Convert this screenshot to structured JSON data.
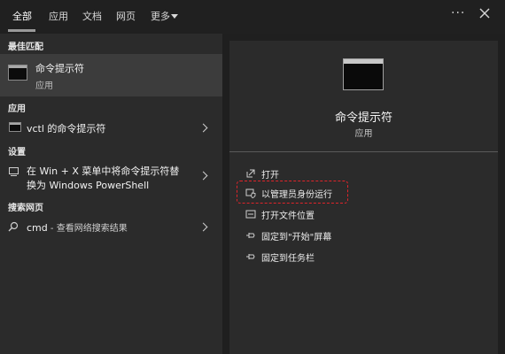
{
  "tabs": [
    {
      "label": "全部"
    },
    {
      "label": "应用"
    },
    {
      "label": "文档"
    },
    {
      "label": "网页"
    },
    {
      "label": "更多"
    }
  ],
  "toolbar": {
    "more_options": "···"
  },
  "left": {
    "best_match_header": "最佳匹配",
    "best_match": {
      "title": "命令提示符",
      "subtitle": "应用"
    },
    "apps_header": "应用",
    "app_item": {
      "title": "vctl 的命令提示符"
    },
    "settings_header": "设置",
    "settings_item": {
      "line1": "在 Win + X 菜单中将命令提示符替",
      "line2": "换为 Windows PowerShell"
    },
    "web_header": "搜索网页",
    "web_item": {
      "query": "cmd",
      "suffix": " - 查看网络搜索结果"
    }
  },
  "right": {
    "title": "命令提示符",
    "subtitle": "应用",
    "actions": [
      {
        "label": "打开",
        "icon": "open-icon"
      },
      {
        "label": "以管理员身份运行",
        "icon": "shield-run-icon"
      },
      {
        "label": "打开文件位置",
        "icon": "folder-icon"
      },
      {
        "label": "固定到\"开始\"屏幕",
        "icon": "pin-icon"
      },
      {
        "label": "固定到任务栏",
        "icon": "pin-icon"
      }
    ]
  },
  "colors": {
    "highlight": "#e0242a",
    "background": "#1f1f1f",
    "panel": "#2b2b2b",
    "selected": "#3c3c3c"
  }
}
